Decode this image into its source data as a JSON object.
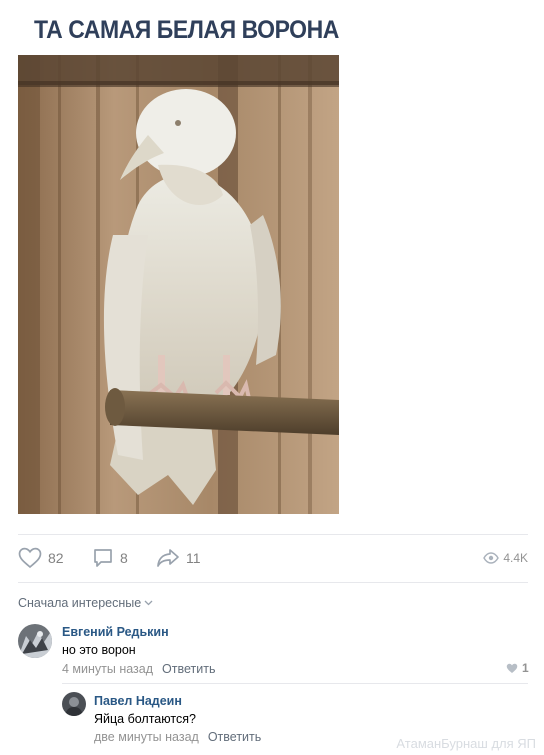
{
  "post": {
    "title": "ТА САМАЯ БЕЛАЯ ВОРОНА",
    "image_icon": "white-raven-photo",
    "likes": "82",
    "comments": "8",
    "shares": "11",
    "views": "4.4K"
  },
  "comments_section": {
    "sort_label": "Сначала интересные",
    "items": [
      {
        "author": "Евгений Редькин",
        "text": "но это ворон",
        "time": "4 минуты назад",
        "reply_label": "Ответить",
        "likes": "1"
      },
      {
        "author": "Павел Надеин",
        "text": "Яйца болтаются?",
        "time": "две минуты назад",
        "reply_label": "Ответить"
      }
    ]
  },
  "colors": {
    "title": "#2f3f5a",
    "author_link": "#2a5885",
    "muted": "#939393",
    "divider": "#e7e8ec"
  },
  "watermark": "АтаманБурнаш для ЯП"
}
